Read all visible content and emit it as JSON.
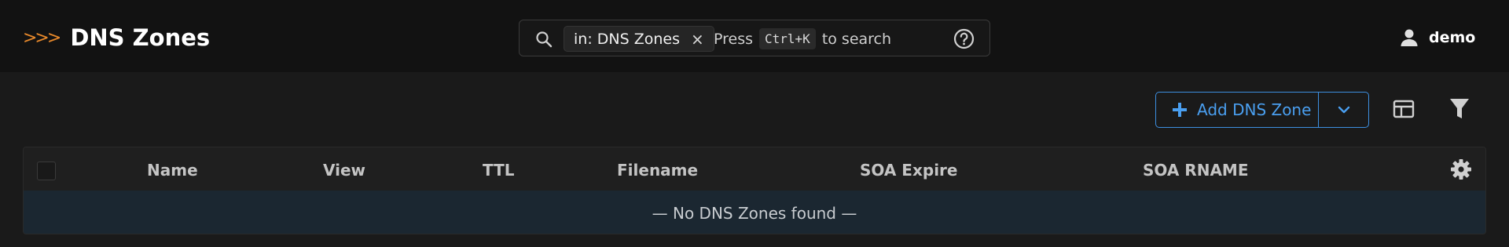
{
  "header": {
    "brand_chevrons": ">>>",
    "title": "DNS Zones"
  },
  "search": {
    "chip_label": "in: DNS Zones",
    "chip_close": "×",
    "hint_prefix": "Press",
    "hint_key": "Ctrl+K",
    "hint_suffix": "to search"
  },
  "user": {
    "name": "demo"
  },
  "toolbar": {
    "add_label": "Add DNS Zone"
  },
  "table": {
    "columns": [
      "Name",
      "View",
      "TTL",
      "Filename",
      "SOA Expire",
      "SOA RNAME"
    ],
    "empty_message": "— No DNS Zones found —"
  },
  "colors": {
    "accent": "#3d8fe0",
    "brand_chevrons": "#e8892b",
    "topbar_bg": "#121212",
    "page_bg": "#1a1a1a",
    "empty_row_bg": "#1b2731"
  },
  "icons": [
    "search-icon",
    "close-icon",
    "help-icon",
    "user-icon",
    "plus-icon",
    "chevron-down-icon",
    "layout-icon",
    "filter-icon",
    "gear-icon"
  ]
}
